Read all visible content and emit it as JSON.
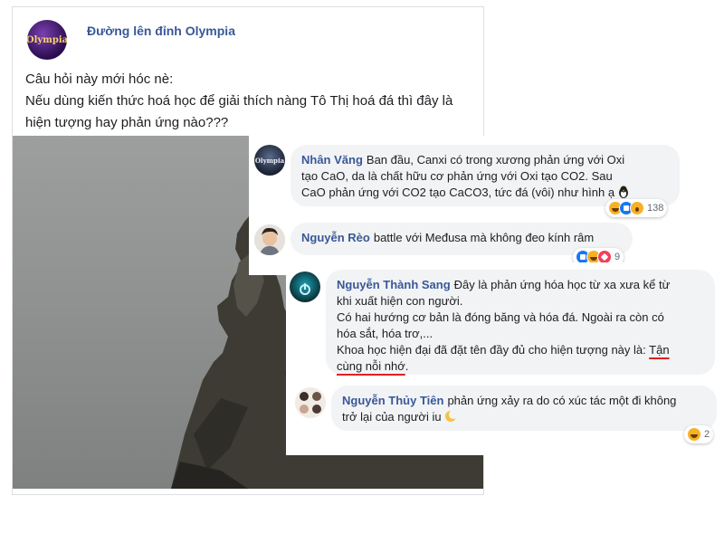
{
  "post": {
    "page_name": "Đường lên đỉnh Olympia",
    "avatar_text": "Olympia",
    "text_lines": [
      "Câu hỏi này mới hóc nè:",
      "Nếu dùng kiến thức hoá học để giải thích nàng Tô Thị hoá đá thì đây là",
      "hiện tượng hay phản ứng nào???"
    ]
  },
  "comments": [
    {
      "author": "Nhân Văng",
      "lines": [
        "Ban đầu, Canxi có trong xương phản ứng với Oxi",
        "tạo CaO, da là chất hữu cơ phản ứng với Oxi tạo CO2. Sau",
        "CaO phản ứng với CO2 tạo CaCO3, tức đá (vôi) như hình ạ"
      ],
      "reaction_count": "138",
      "avatar_text": "Olympia"
    },
    {
      "author": "Nguyễn Rèo",
      "lines": [
        "battle với Međusa mà không đeo kính râm"
      ],
      "reaction_count": "9"
    },
    {
      "author": "Nguyễn Thành Sang",
      "lines": [
        "Đây là phản ứng hóa học từ xa xưa kể từ",
        "khi xuất hiện con người.",
        "Có hai hướng cơ bản là đóng băng và hóa đá. Ngoài ra còn có",
        "hóa sắt, hóa trơ,...",
        "Khoa học hiện đại đã đặt tên đầy đủ cho hiện tượng này là:"
      ],
      "underlined_part1": "Tận",
      "underlined_part2": "cùng nỗi nhớ"
    },
    {
      "author": "Nguyễn Thủy Tiên",
      "lines": [
        "phản ứng xảy ra do có xúc tác một đi không",
        "trở lại của người iu"
      ],
      "reaction_count": "2"
    }
  ],
  "colors": {
    "author": "#385898",
    "bubble": "#f2f3f5",
    "underline": "#e02020"
  }
}
